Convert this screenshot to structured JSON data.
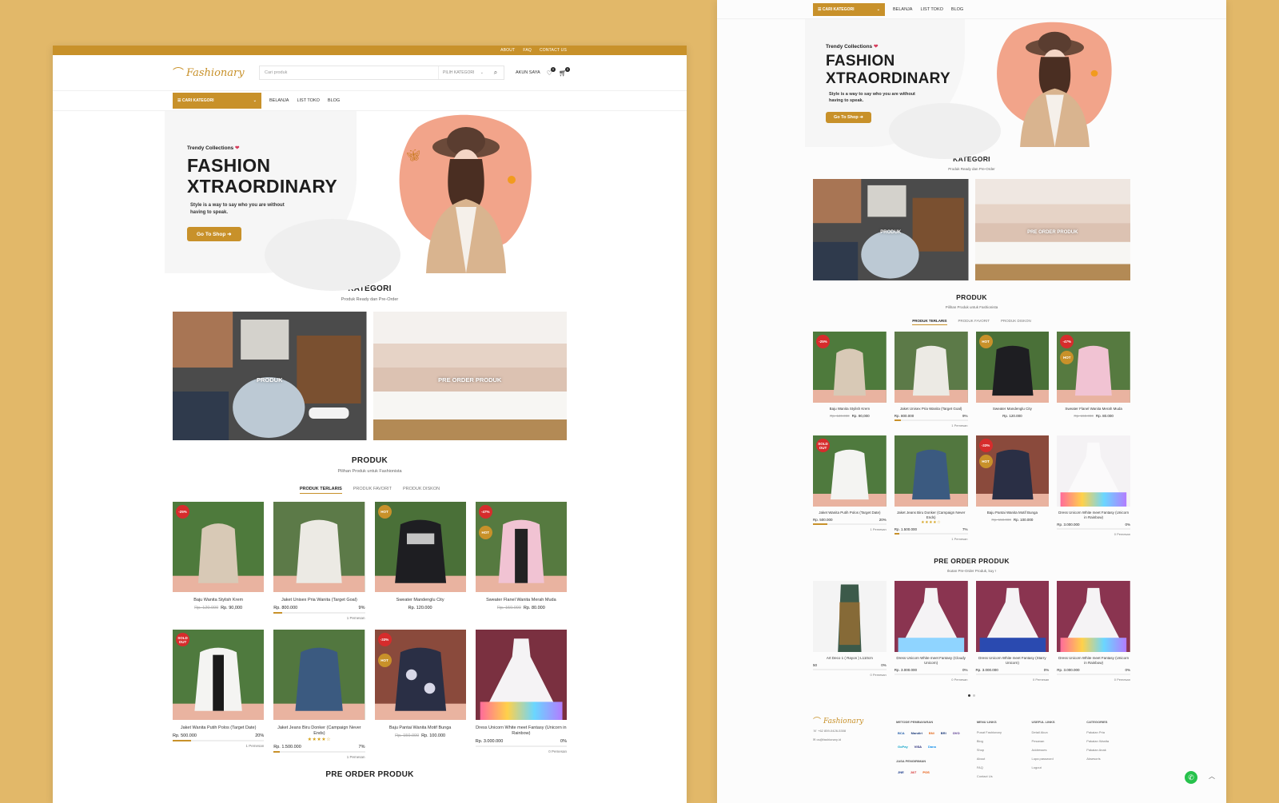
{
  "topbar": {
    "links": [
      "ABOUT",
      "FAQ",
      "CONTACT US"
    ]
  },
  "header": {
    "logo_text": "Fashionary",
    "search_placeholder": "Cari produk",
    "category_select": "PILIH KATEGORI",
    "account_label": "AKUN SAYA",
    "wishlist_count": "0",
    "cart_count": "0"
  },
  "nav": {
    "category_button": "CARI KATEGORI",
    "links": [
      "BELANJA",
      "LIST TOKO",
      "BLOG"
    ]
  },
  "hero": {
    "kicker": "Trendy Collections",
    "title_line1": "FASHION",
    "title_line2": "XTRAORDINARY",
    "tagline": "Style is a way to say who you are without having to speak.",
    "cta": "Go To Shop"
  },
  "kategori": {
    "title": "KATEGORI",
    "subtitle": "Produk Ready dan Pre-Order",
    "cards": [
      "PRODUK",
      "PRE ORDER PRODUK"
    ]
  },
  "produk": {
    "title": "PRODUK",
    "subtitle": "Pilihan Produk untuk Fashionista",
    "tabs": [
      "PRODUK TERLARIS",
      "PRODUK FAVORIT",
      "PRODUK DISKON"
    ],
    "items": [
      {
        "name": "Baju Wanita Stylish Krem",
        "old": "Rp. 120.000",
        "price": "Rp. 90,000",
        "badges": [
          "-25%"
        ]
      },
      {
        "name": "Jaket Unisex Pria Wanita (Target Goal)",
        "price": "Rp. 800.000",
        "pct": "9%",
        "progress": 9,
        "sold": "1 Pemesan"
      },
      {
        "name": "Sweater Mandenglu City",
        "price": "Rp. 120.000",
        "badges": [
          "HOT"
        ]
      },
      {
        "name": "Sweater Flanel Wanita Merah Muda",
        "old": "Rp. 150.000",
        "price": "Rp. 80.000",
        "badges": [
          "-47%",
          "HOT"
        ]
      },
      {
        "name": "Jaket Wanita Putih Polos (Target Date)",
        "price": "Rp. 500.000",
        "pct": "20%",
        "progress": 20,
        "sold": "1 Pemesan",
        "badges": [
          "SOLD OUT"
        ]
      },
      {
        "name": "Jaket Jeans Biru Donker (Campaign Never Ends)",
        "price": "Rp. 1.500.000",
        "pct": "7%",
        "progress": 7,
        "sold": "1 Pemesan",
        "stars": "★★★★☆"
      },
      {
        "name": "Baju Pantai Wanita Motif Bunga",
        "old": "Rp. 150.000",
        "price": "Rp. 100.000",
        "badges": [
          "-33%",
          "HOT"
        ]
      },
      {
        "name": "Dress Unicorn White meet Fantasy (Unicorn in Rainbow)",
        "price": "Rp. 3.000.000",
        "pct": "0%",
        "progress": 0,
        "sold": "0 Pemesan"
      }
    ]
  },
  "preorder": {
    "title": "PRE ORDER PRODUK",
    "subtitle": "Ikutan Pre-Order Produk, kuy !",
    "items": [
      {
        "name": "Art Deco 1 ( Rayon ) L110cm",
        "price": "50",
        "pct": "0%",
        "progress": 0,
        "sold": "0 Pemesan"
      },
      {
        "name": "Dress Unicorn White meet Fantasy (Cloudy Unicorn)",
        "price": "Rp. 3.000.000",
        "pct": "0%",
        "progress": 0,
        "sold": "0 Pemesan"
      },
      {
        "name": "Dress Unicorn White meet Fantasy (Starry Unicorn)",
        "price": "Rp. 3.000.000",
        "pct": "0%",
        "progress": 0,
        "sold": "0 Pemesan"
      },
      {
        "name": "Dress Unicorn White meet Fantasy (Unicorn in Rainbow)",
        "price": "Rp. 3.000.000",
        "pct": "0%",
        "progress": 0,
        "sold": "0 Pemesan"
      }
    ]
  },
  "footer": {
    "phone": "+62 859-0426-5308",
    "email": "cs@fashionary.id",
    "payment_title": "METODE PEMBAYARAN",
    "payments": [
      "BCA",
      "Mandiri",
      "BNI",
      "BRI",
      "OVO",
      "GoPay",
      "VISA",
      "Dana"
    ],
    "shipping_title": "JASA PENGIRIMAN",
    "shipping": [
      "JNE",
      "J&T",
      "POS"
    ],
    "menu_title": "MENU LINKS",
    "menu": [
      "Pusat Fashionary",
      "Blog",
      "Shop",
      "About",
      "FAQ",
      "Contact Us"
    ],
    "useful_title": "USEFUL LINKS",
    "useful": [
      "Detail Akun",
      "Pesanan",
      "Addresses",
      "Lupa password",
      "Logout"
    ],
    "categories_title": "CATEGORIES",
    "categories": [
      "Pakaian Pria",
      "Pakaian Wanita",
      "Pakaian Anak",
      "Aksesoris"
    ]
  },
  "colors": {
    "accent": "#c8912a",
    "badge_red": "#d62c2c",
    "background": "#e2b869"
  }
}
